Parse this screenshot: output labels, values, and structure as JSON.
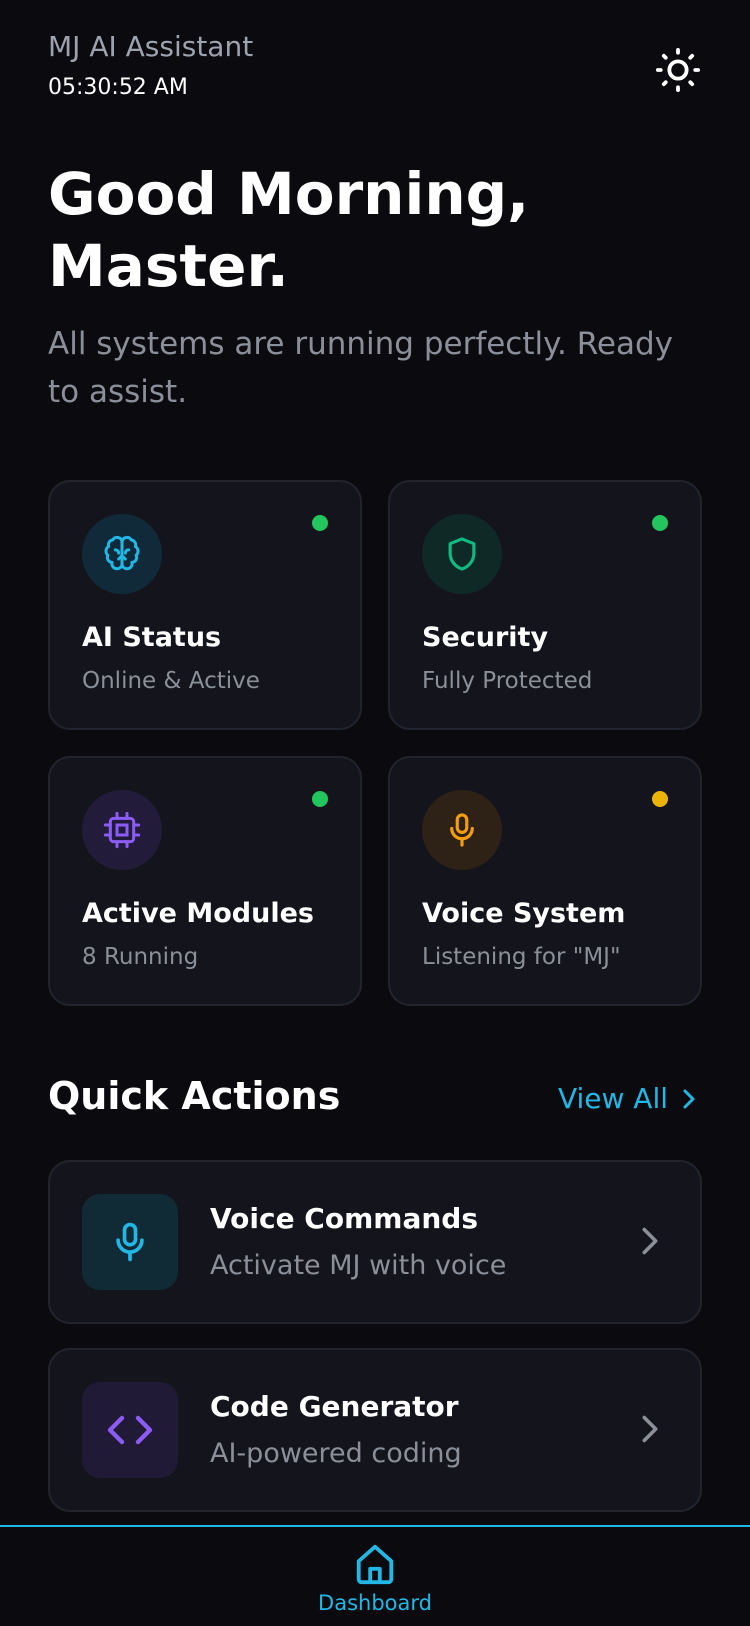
{
  "header": {
    "app_name": "MJ AI Assistant",
    "time": "05:30:52 AM",
    "theme_icon": "sun-icon"
  },
  "hero": {
    "greeting": "Good Morning, Master.",
    "subtitle": "All systems are running perfectly. Ready to assist."
  },
  "status_cards": [
    {
      "title": "AI Status",
      "subtitle": "Online & Active",
      "icon": "brain-icon",
      "accent": "#22b8e6",
      "indicator": "#22c55e"
    },
    {
      "title": "Security",
      "subtitle": "Fully Protected",
      "icon": "shield-icon",
      "accent": "#10b981",
      "indicator": "#22c55e"
    },
    {
      "title": "Active Modules",
      "subtitle": "8 Running",
      "icon": "cpu-chip-icon",
      "accent": "#8b5cf6",
      "indicator": "#22c55e"
    },
    {
      "title": "Voice System",
      "subtitle": "Listening for \"MJ\"",
      "icon": "microphone-icon",
      "accent": "#f59e0b",
      "indicator": "#eab308"
    }
  ],
  "quick_actions": {
    "title": "Quick Actions",
    "view_all": "View All",
    "items": [
      {
        "title": "Voice Commands",
        "subtitle": "Activate MJ with voice",
        "icon": "microphone-icon",
        "accent": "#22b8e6"
      },
      {
        "title": "Code Generator",
        "subtitle": "AI-powered coding",
        "icon": "code-icon",
        "accent": "#8b5cf6"
      }
    ]
  },
  "bottom_nav": {
    "items": [
      {
        "label": "Dashboard",
        "icon": "home-icon",
        "active": true
      }
    ]
  }
}
